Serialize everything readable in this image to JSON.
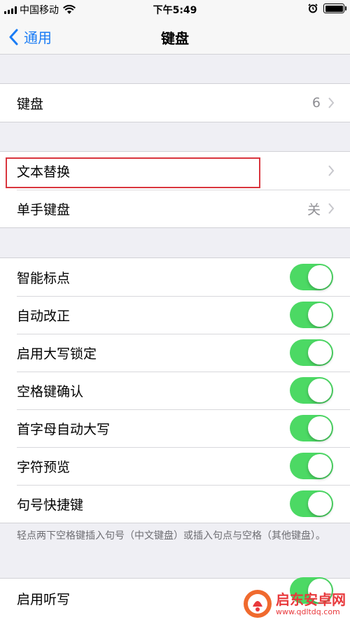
{
  "status_bar": {
    "carrier": "中国移动",
    "time": "下午5:49"
  },
  "nav": {
    "back_label": "通用",
    "title": "键盘"
  },
  "group1": {
    "keyboards": {
      "label": "键盘",
      "value": "6"
    }
  },
  "group2": {
    "text_replacement": {
      "label": "文本替换"
    },
    "one_handed": {
      "label": "单手键盘",
      "value": "关"
    }
  },
  "group3": {
    "items": [
      {
        "label": "智能标点",
        "on": true
      },
      {
        "label": "自动改正",
        "on": true
      },
      {
        "label": "启用大写锁定",
        "on": true
      },
      {
        "label": "空格键确认",
        "on": true
      },
      {
        "label": "首字母自动大写",
        "on": true
      },
      {
        "label": "字符预览",
        "on": true
      },
      {
        "label": "句号快捷键",
        "on": true
      }
    ],
    "footnote": "轻点两下空格键插入句号（中文键盘）或插入句点与空格（其他键盘）。"
  },
  "group4": {
    "dictation": {
      "label": "启用听写",
      "on": true
    }
  },
  "watermark": {
    "name": "启东安卓网",
    "url": "www.qdltdq.com"
  },
  "colors": {
    "accent": "#1a7cf5",
    "toggle_on": "#4cd964",
    "highlight": "#d9363e"
  }
}
